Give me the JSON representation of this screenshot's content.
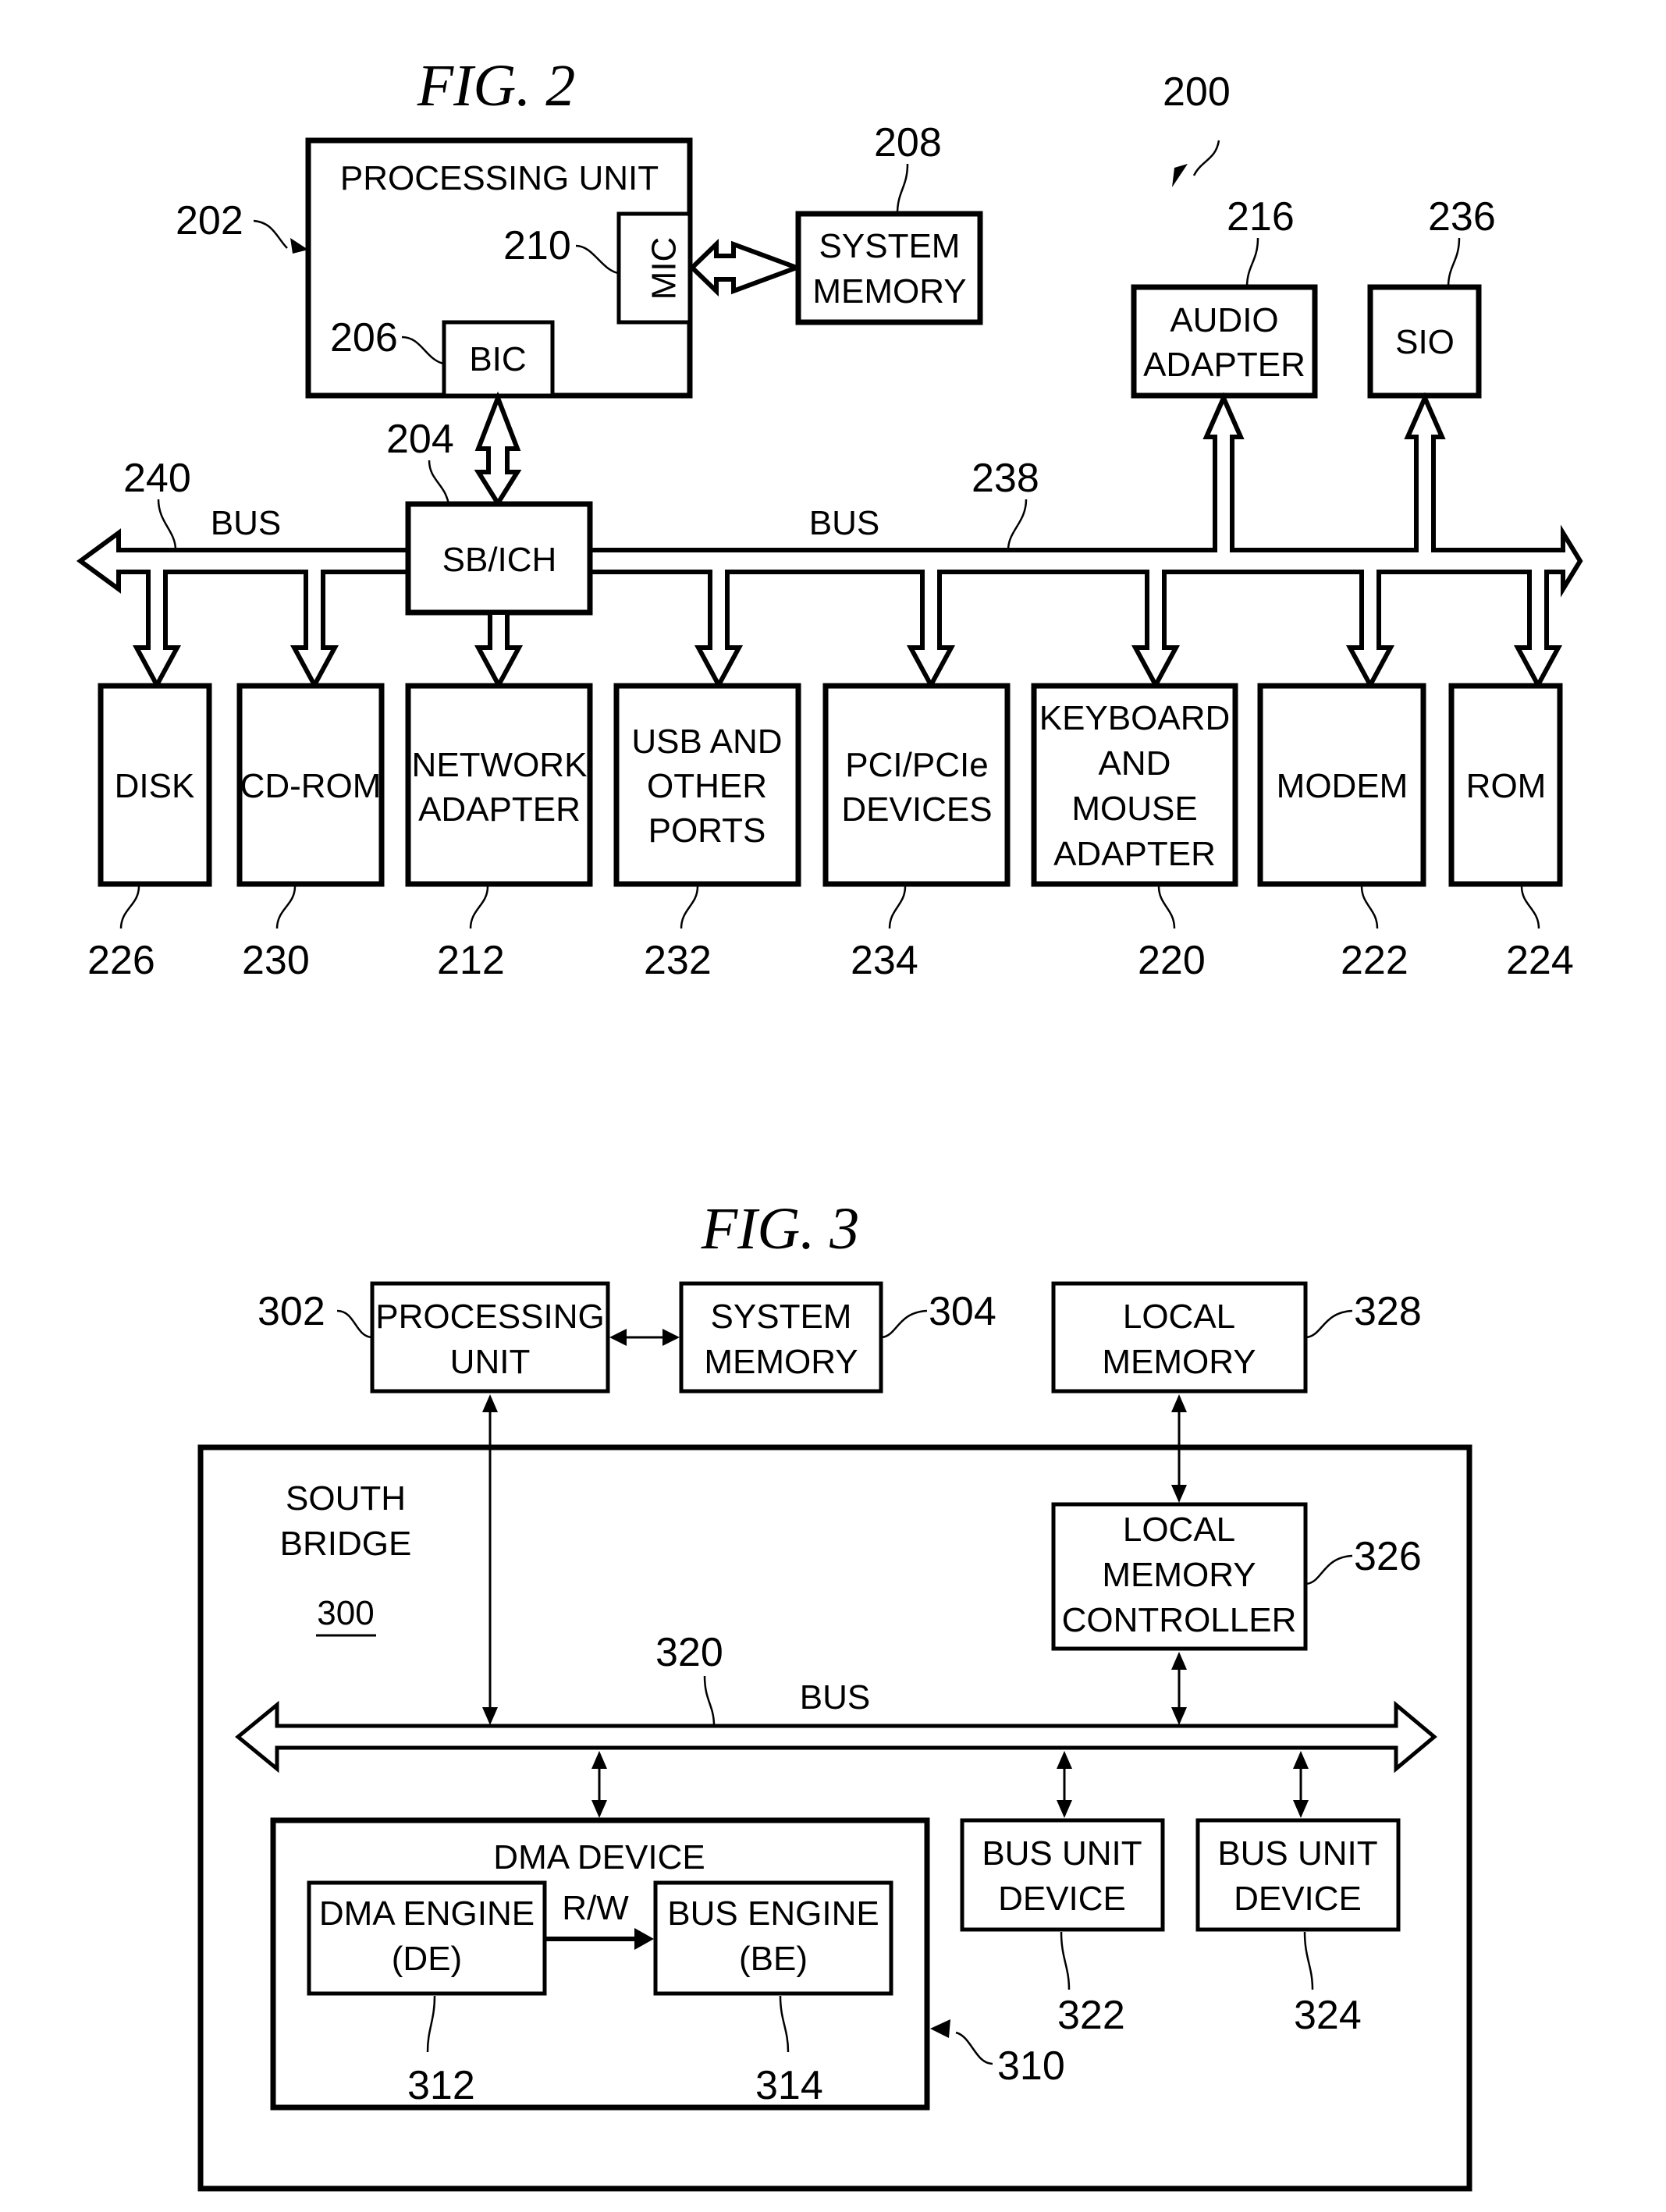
{
  "fig2": {
    "title": "FIG. 2",
    "system_ref": "200",
    "processing_unit": {
      "label": "PROCESSING UNIT",
      "ref": "202"
    },
    "mic": {
      "label": "MIC",
      "ref": "210"
    },
    "bic": {
      "label": "BIC",
      "ref": "206"
    },
    "system_memory": {
      "label_lines": [
        "SYSTEM",
        "MEMORY"
      ],
      "ref": "208"
    },
    "audio_adapter": {
      "label_lines": [
        "AUDIO",
        "ADAPTER"
      ],
      "ref": "216"
    },
    "sio": {
      "label": "SIO",
      "ref": "236"
    },
    "sb_ich": {
      "label": "SB/ICH",
      "ref": "204"
    },
    "bus_left": {
      "label": "BUS",
      "ref": "240"
    },
    "bus_right": {
      "label": "BUS",
      "ref": "238"
    },
    "devices": [
      {
        "lines": [
          "DISK"
        ],
        "ref": "226"
      },
      {
        "lines": [
          "CD-ROM"
        ],
        "ref": "230"
      },
      {
        "lines": [
          "NETWORK",
          "ADAPTER"
        ],
        "ref": "212"
      },
      {
        "lines": [
          "USB AND",
          "OTHER",
          "PORTS"
        ],
        "ref": "232"
      },
      {
        "lines": [
          "PCI/PCIe",
          "DEVICES"
        ],
        "ref": "234"
      },
      {
        "lines": [
          "KEYBOARD",
          "AND",
          "MOUSE",
          "ADAPTER"
        ],
        "ref": "220"
      },
      {
        "lines": [
          "MODEM"
        ],
        "ref": "222"
      },
      {
        "lines": [
          "ROM"
        ],
        "ref": "224"
      }
    ]
  },
  "fig3": {
    "title": "FIG. 3",
    "processing_unit": {
      "label_lines": [
        "PROCESSING",
        "UNIT"
      ],
      "ref": "302"
    },
    "system_memory": {
      "label_lines": [
        "SYSTEM",
        "MEMORY"
      ],
      "ref": "304"
    },
    "local_memory": {
      "label_lines": [
        "LOCAL",
        "MEMORY"
      ],
      "ref": "328"
    },
    "south_bridge": {
      "label_lines": [
        "SOUTH",
        "BRIDGE"
      ],
      "ref": "300"
    },
    "local_memory_controller": {
      "label_lines": [
        "LOCAL",
        "MEMORY",
        "CONTROLLER"
      ],
      "ref": "326"
    },
    "bus": {
      "label": "BUS",
      "ref": "320"
    },
    "dma_device": {
      "label": "DMA DEVICE",
      "ref": "310"
    },
    "dma_engine": {
      "label_lines": [
        "DMA ENGINE",
        "(DE)"
      ],
      "ref": "312"
    },
    "bus_engine": {
      "label_lines": [
        "BUS ENGINE",
        "(BE)"
      ],
      "ref": "314"
    },
    "rw_label": "R/W",
    "bus_unit_1": {
      "label_lines": [
        "BUS UNIT",
        "DEVICE"
      ],
      "ref": "322"
    },
    "bus_unit_2": {
      "label_lines": [
        "BUS UNIT",
        "DEVICE"
      ],
      "ref": "324"
    }
  }
}
